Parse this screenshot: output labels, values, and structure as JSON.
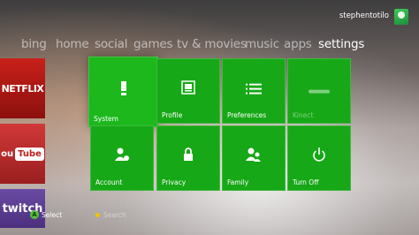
{
  "user": {
    "name": "stephentotilo"
  },
  "nav": {
    "items": [
      "bing",
      "home",
      "social",
      "games",
      "tv & movies",
      "music",
      "apps",
      "settings"
    ],
    "active": "settings"
  },
  "apps": {
    "netflix": "NETFLIX",
    "youtube_prefix": "ou",
    "youtube_box": "Tube",
    "twitch": "twitch"
  },
  "tiles": [
    {
      "label": "System",
      "icon": "system-icon"
    },
    {
      "label": "Profile",
      "icon": "profile-icon"
    },
    {
      "label": "Preferences",
      "icon": "preferences-icon"
    },
    {
      "label": "Kinect",
      "icon": "kinect-icon"
    },
    {
      "label": "Account",
      "icon": "account-icon"
    },
    {
      "label": "Privacy",
      "icon": "lock-icon"
    },
    {
      "label": "Family",
      "icon": "family-icon"
    },
    {
      "label": "Turn Off",
      "icon": "power-icon"
    }
  ],
  "footer": {
    "a_button": "A",
    "select": "Select",
    "search": "Search"
  },
  "colors": {
    "tile_green": "#17a817",
    "accent_green": "#53c23a",
    "y_button": "#f2c200"
  }
}
